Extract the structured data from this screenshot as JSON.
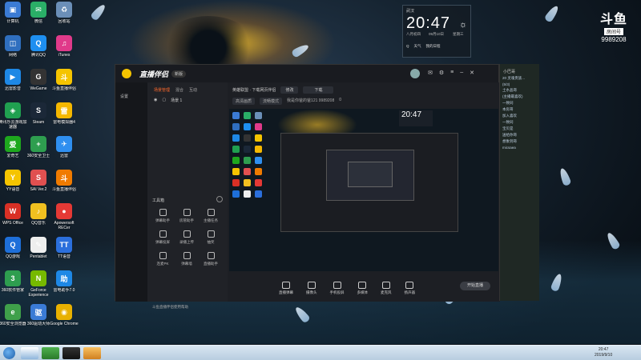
{
  "desktop": {
    "icons_col1": [
      {
        "label": "计算机",
        "icon": "computer-icon",
        "color": "#3b7bd4",
        "glyph": "▣"
      },
      {
        "label": "网络",
        "icon": "network-icon",
        "color": "#2f6fbf",
        "glyph": "◫"
      },
      {
        "label": "迅雷影音",
        "icon": "xunlei-icon",
        "color": "#1e88e5",
        "glyph": "▶"
      },
      {
        "label": "腾讯乐云游戏加速器",
        "icon": "tencent-accel-icon",
        "color": "#20a050",
        "glyph": "◈"
      },
      {
        "label": "爱奇艺",
        "icon": "iqiyi-icon",
        "color": "#1ea81e",
        "glyph": "爱"
      },
      {
        "label": "YY语音",
        "icon": "yy-icon",
        "color": "#f5c400",
        "glyph": "Y"
      },
      {
        "label": "WPS Office",
        "icon": "wps-icon",
        "color": "#d93025",
        "glyph": "W"
      },
      {
        "label": "QQ游戏",
        "icon": "qq-game-icon",
        "color": "#1e6fd9",
        "glyph": "Q"
      },
      {
        "label": "360软件管家",
        "icon": "360-soft-icon",
        "color": "#2e9e4f",
        "glyph": "3"
      },
      {
        "label": "360安全浏览器",
        "icon": "360-browser-icon",
        "color": "#3fa04a",
        "glyph": "e"
      }
    ],
    "icons_col2": [
      {
        "label": "微信",
        "icon": "wechat-icon",
        "color": "#2aae67",
        "glyph": "✉"
      },
      {
        "label": "腾讯QQ",
        "icon": "qq-icon",
        "color": "#1e8ff0",
        "glyph": "Q"
      },
      {
        "label": "WeGame",
        "icon": "wegame-icon",
        "color": "#333333",
        "glyph": "G"
      },
      {
        "label": "Steam",
        "icon": "steam-icon",
        "color": "#1b2838",
        "glyph": "S"
      },
      {
        "label": "360安全卫士",
        "icon": "360-safe-icon",
        "color": "#2e9e4f",
        "glyph": "+"
      },
      {
        "label": "SAI Ver.2",
        "icon": "sai-icon",
        "color": "#e05050",
        "glyph": "S"
      },
      {
        "label": "QQ音乐",
        "icon": "qq-music-icon",
        "color": "#f0c020",
        "glyph": "♪"
      },
      {
        "label": "Pentablet",
        "icon": "pentablet-icon",
        "color": "#eeeeee",
        "glyph": "✎"
      },
      {
        "label": "GeForce Experience",
        "icon": "geforce-icon",
        "color": "#76b900",
        "glyph": "N"
      },
      {
        "label": "360驱动大师",
        "icon": "360-driver-icon",
        "color": "#3a7bd5",
        "glyph": "驱"
      }
    ],
    "icons_col3": [
      {
        "label": "回收站",
        "icon": "recycle-bin-icon",
        "color": "#6b8fb8",
        "glyph": "♻"
      },
      {
        "label": "iTunes",
        "icon": "itunes-icon",
        "color": "#e03a8a",
        "glyph": "♫"
      },
      {
        "label": "斗鱼直播伴侣",
        "icon": "douyu-companion-icon",
        "color": "#f5c400",
        "glyph": "斗"
      },
      {
        "label": "雷电模拟器4",
        "icon": "ldplayer-icon",
        "color": "#f5b800",
        "glyph": "雷"
      },
      {
        "label": "迅雷",
        "icon": "thunder-icon",
        "color": "#2f8ff0",
        "glyph": "✈"
      },
      {
        "label": "斗鱼直播伴侣",
        "icon": "douyu-companion2-icon",
        "color": "#f07b00",
        "glyph": "斗"
      },
      {
        "label": "Apowersoft RECer",
        "icon": "apowerrec-icon",
        "color": "#e53935",
        "glyph": "●"
      },
      {
        "label": "TT语音",
        "icon": "tt-voice-icon",
        "color": "#2b6fdc",
        "glyph": "TT"
      },
      {
        "label": "雷电助手7.0",
        "icon": "ld-assist-icon",
        "color": "#1e88e5",
        "glyph": "助"
      },
      {
        "label": "Google Chrome",
        "icon": "chrome-icon",
        "color": "#e8b100",
        "glyph": "◉"
      }
    ]
  },
  "clock_widget": {
    "location": "武汉",
    "time": "20:47",
    "date": "八月初四",
    "day": "09月10日",
    "weekday": "星期三",
    "buttons": [
      "Q",
      "天气",
      "我的日程"
    ]
  },
  "watermark": {
    "logo": "斗鱼",
    "room_label": "房间号",
    "room_number": "9989208"
  },
  "app": {
    "brand": "直播伴侣",
    "version": "新版",
    "sidebar_nav": "设置",
    "panel_tabs": [
      "场景管理",
      "混合",
      "互动"
    ],
    "scene_label": "场景 1",
    "tools_title": "工具箱",
    "tools": [
      {
        "label": "弹幕助手",
        "icon": "barrage-icon"
      },
      {
        "label": "房管助手",
        "icon": "admin-icon"
      },
      {
        "label": "主播任务",
        "icon": "task-icon"
      },
      {
        "label": "弹幕投屏",
        "icon": "barrage-cast-icon"
      },
      {
        "label": "录播上传",
        "icon": "upload-icon"
      },
      {
        "label": "抽奖",
        "icon": "lottery-icon"
      },
      {
        "label": "连麦PK",
        "icon": "pk-icon"
      },
      {
        "label": "弹幕墙",
        "icon": "wall-icon"
      },
      {
        "label": "直播助手",
        "icon": "assist-icon"
      }
    ],
    "footer": "斗鱼直播伴侣使用帮助",
    "topbar": {
      "title": "英雄联盟 · 下载网页伴侣",
      "btn1": "修改",
      "btn2": "下载",
      "mode": "高清画质",
      "quality": "流畅模式",
      "room_info": "我是你爸的爸121 9989208",
      "fans": "0"
    },
    "bottom_tools": [
      {
        "label": "直播弹幕",
        "icon": "live-barrage-icon"
      },
      {
        "label": "摄像头",
        "icon": "camera-icon"
      },
      {
        "label": "手机投屏",
        "icon": "phone-cast-icon"
      },
      {
        "label": "多媒体",
        "icon": "media-icon"
      },
      {
        "label": "麦克风",
        "icon": "mic-icon"
      },
      {
        "label": "扬声器",
        "icon": "speaker-icon"
      }
    ],
    "start_button": "开始直播"
  },
  "chat": {
    "title": "小巴哥",
    "lines": [
      "20 灵魂贵族...",
      "(5/3)",
      "土水晶哥",
      "(主播最喜欢)",
      "一致同",
      "本房哥",
      "加入喜欢",
      "一致同",
      "宝贝是",
      "送给你哥",
      "想象到哥",
      "micsaea"
    ]
  },
  "taskbar": {
    "time": "20:47",
    "date": "2019/9/10"
  },
  "colors": {
    "accent": "#ff6a2c",
    "taskbar": "#c8d9e8"
  }
}
